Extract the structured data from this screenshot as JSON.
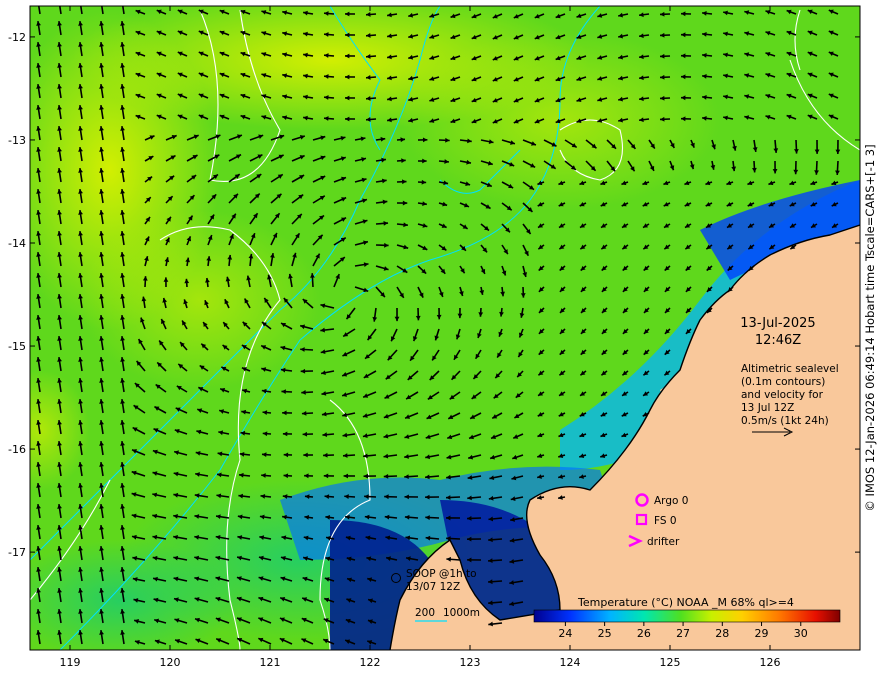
{
  "map": {
    "lon_ticks": [
      "119",
      "120",
      "121",
      "122",
      "123",
      "124",
      "125",
      "126"
    ],
    "lat_ticks": [
      "-12",
      "-13",
      "-14",
      "-15",
      "-16",
      "-17"
    ],
    "lon_range": [
      118.6,
      126.9
    ],
    "lat_range": [
      -11.7,
      -17.95
    ]
  },
  "datetime": {
    "date": "13-Jul-2025",
    "time": "12:46Z"
  },
  "info": {
    "line1": "Altimetric sealevel",
    "line2": "(0.1m contours)",
    "line3": "and velocity for",
    "line4": "13 Jul 12Z",
    "line5": "0.5m/s (1kt 24h)"
  },
  "legend": {
    "argo": "Argo 0",
    "fs": "FS 0",
    "drifter": "drifter",
    "soop1": "SOOP @1h to",
    "soop2": "13/07 12Z",
    "depth1": "200",
    "depth2": "1000m"
  },
  "colorbar": {
    "title": "Temperature (°C) NOAA _M 68% ql>=4",
    "ticks": [
      "24",
      "25",
      "26",
      "27",
      "28",
      "29",
      "30"
    ],
    "range": [
      23.2,
      31.0
    ]
  },
  "credit": "© IMOS 12-Jan-2026 06:49:14 Hobart time Tscale=CARS+[-1 3]",
  "colors": {
    "land": "#f9c89b",
    "ocean_warm": "#7fe01a",
    "argo": "#ff00ff"
  }
}
